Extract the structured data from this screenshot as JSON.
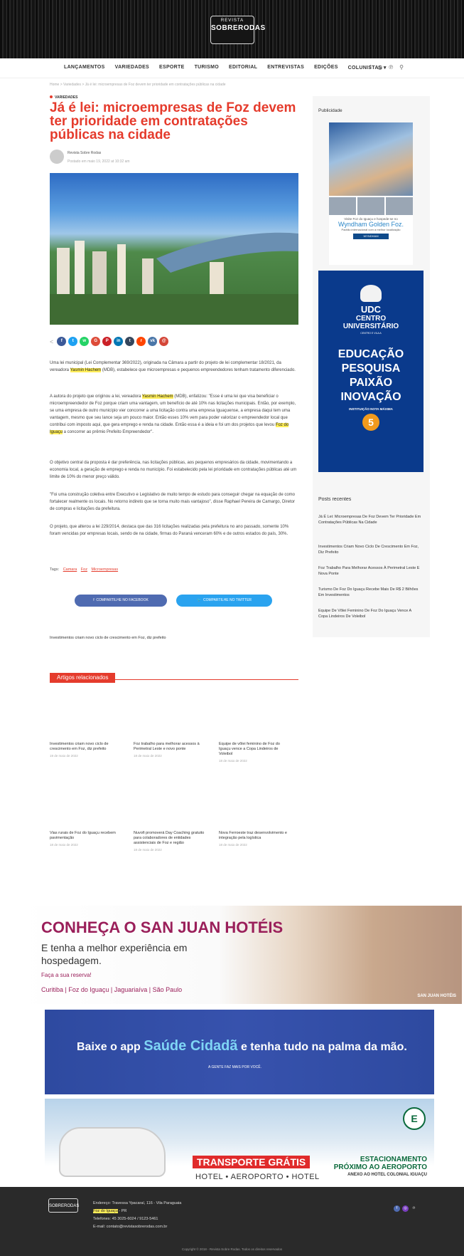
{
  "header": {
    "logo_small": "REVISTA",
    "logo_big": "SOBRERODAS",
    "nav": [
      "LANÇAMENTOS",
      "VARIEDADES",
      "ESPORTE",
      "TURISMO",
      "EDITORIAL",
      "ENTREVISTAS",
      "EDIÇÕES",
      "COLUNISTAS ▾"
    ],
    "icons": [
      "facebook-icon",
      "instagram-icon",
      "pinterest-icon",
      "search-icon"
    ]
  },
  "breadcrumb": "Home > Variedades > Já é lei: microempresas de Foz devem ter prioridade em contratações públicas na cidade",
  "article": {
    "category": "VARIEDADES",
    "title": "Já é lei: microempresas de Foz devem ter prioridade em contratações públicas na cidade",
    "author": "Revista Sobre Rodas",
    "date": "Postado em maio 19, 2022 at 10:32 am",
    "share_icons": [
      "facebook",
      "twitter",
      "whatsapp",
      "google",
      "pinterest",
      "linkedin",
      "tumblr",
      "reddit",
      "vk",
      "email"
    ],
    "paragraphs": [
      [
        "Uma lei municipal (Lei Complementar 369/2022), originada na Câmara a partir do projeto de lei complementar 18/2021, da vereadora ",
        "Yasmin Hachem",
        " (MDB), estabelece que microempresas e pequenos empreendedores tenham tratamento diferenciado."
      ],
      [
        "A autora do projeto que originou a lei, vereadora ",
        "Yasmin Hachem",
        " (MDB), enfatizou: \"Esse é uma lei que visa beneficiar o microempreendedor de Foz porque criam uma vantagem, um benefício de até 10% nas licitações municipais. Então, por exemplo, se uma empresa de outro município vier concorrer a uma licitação contra uma empresa Iguaçuense, a empresa daqui tem uma vantagem, mesmo que seu lance seja um pouco maior. Então esses 10% vem para poder valorizar o empreendedor local que contribui com imposto aqui, que gera emprego e renda na cidade. Então essa é a ideia e foi um dos projetos que levou ",
        "Foz do Iguaçu",
        " a concorrer ao prêmio Prefeito Empreendedor\"."
      ],
      [
        "O objetivo central da proposta é dar preferência, nas licitações públicas, aos pequenos empresários da cidade, movimentando a economia local, a geração de emprego e renda no município. Foi estabelecido pela lei prioridade em contratações públicas até um limite de 10% do menor preço válido.",
        "",
        ""
      ],
      [
        "\"Foi uma construção coletiva entre Executivo e Legislativo de muito tempo de estudo para conseguir chegar na equação de como fortalecer realmente os locais. No retorno indireto que se torna muito mais vantajoso\", disse Raphael Pereira de Camargo, Diretor de compras e licitações da prefeitura.",
        "",
        ""
      ],
      [
        "O projeto, que alterou a lei 229/2014, destaca que das 316 licitações realizadas pela prefeitura no ano passado, somente 10% foram vencidas por empresas locais, sendo de na cidade, firmas do Paraná venceram 60% e de outros estados do país, 30%.",
        "",
        ""
      ]
    ],
    "tags_label": "Tags:",
    "tags": [
      "Camara",
      "Foz",
      "Microempresas"
    ],
    "share_fb": "COMPARTILHE NO FACEBOOK",
    "share_tw": "COMPARTILHE NO TWITTER",
    "next_post": "Investimentos criam novo ciclo de crescimento em Foz, diz prefeito"
  },
  "related": {
    "heading": "Artigos relacionados",
    "items": [
      {
        "title": "Investimentos criam novo ciclo de crescimento em Foz, diz prefeito",
        "date": "19 de maio de 2022"
      },
      {
        "title": "Foz trabalho para melhorar acessos à Perimetral Leste e novo ponte",
        "date": "18 de maio de 2022"
      },
      {
        "title": "Equipe de vôlei feminino de Foz do Iguaçu vence a Copa Lindeiros de Voleibol",
        "date": "18 de maio de 2022"
      },
      {
        "title": "Vias rurais de Foz do Iguaçu recebem pavimentação",
        "date": "18 de maio de 2022"
      },
      {
        "title": "Nuvofi promoverá Day Coaching gratuito para colaboradores de entidades assistenciais de Foz e região",
        "date": "18 de maio de 2022"
      },
      {
        "title": "Nova Ferroeste traz desenvolvimento e integração pela logística",
        "date": "18 de maio de 2022"
      }
    ]
  },
  "sidebar": {
    "ad_title": "Publicidade",
    "wyndham_line1": "Visite Foz do Iguaçu e hospede-se no",
    "wyndham_name": "Wyndham Golden Foz.",
    "wyndham_line2": "Padrão internacional com a melhor localização",
    "wyndham_brand": "WYNDHAM",
    "udc": {
      "name": "UDC",
      "line1": "CENTRO",
      "line2": "UNIVERSITÁRIO",
      "small": "CENTRO E VILA A",
      "w1": "EDUCAÇÃO",
      "w2": "PESQUISA",
      "w3": "PAIXÃO",
      "w4": "INOVAÇÃO",
      "inst": "INSTITUIÇÃO NOTA MÁXIMA",
      "grade": "5"
    },
    "recent_title": "Posts recentes",
    "recent": [
      "Já É Lei: Microempresas De Foz Devem Ter Prioridade Em Contratações Públicas Na Cidade",
      "Investimentos Criam Novo Ciclo De Crescimento Em Foz, Diz Prefeito",
      "Foz Trabalho Para Melhorar Acessos À Perimetral Leste E Nova Ponte",
      "Turismo De Foz Do Iguaçu Recebe Mais De R$ 2 Bilhões Em Investimentos",
      "Equipe De Vôlei Feminino De Foz Do Iguaçu Vence A Copa Lindeiros De Voleibol"
    ]
  },
  "banners": {
    "sanjuan": {
      "heading": "CONHEÇA O SAN JUAN HOTÉIS",
      "sub": "E tenha a melhor experiência em hospedagem.",
      "cta": "Faça a sua reserva!",
      "cities": "Curitiba | Foz do Iguaçu | Jaguariaíva | São Paulo",
      "brand": "SAN JUAN HOTÉIS"
    },
    "saude": {
      "pre": "Baixe o app ",
      "app": "Saúde Cidadã",
      "post": " e tenha tudo na palma da mão.",
      "sub": "A GENTE FAZ MAIS POR VOCÊ."
    },
    "colonial": {
      "badge": "E",
      "transport": "TRANSPORTE GRÁTIS",
      "route": "HOTEL • AEROPORTO • HOTEL",
      "r1": "ESTACIONAMENTO",
      "r2": "PRÓXIMO AO AEROPORTO",
      "r3": "ANEXO AO HOTEL COLONIAL IGUAÇU"
    }
  },
  "footer": {
    "logo": "SOBRERODAS",
    "address": "Endereço: Travessa Ypacaraí, 116 - Vila Paraguaia",
    "city": "Foz do Iguaçu",
    "state": " - PR",
    "phones": "Telefones: 45 3025-6024 / 9123-5461",
    "email": "E-mail: contato@revistasobrerodas.com.br",
    "copyright": "Copyright © 2018 - Revista Sobre Rodas. Todos os direitos reservados"
  },
  "colors": {
    "accent": "#e53b2c",
    "highlight": "#ffee58",
    "facebook": "#4f6bb1",
    "twitter": "#2aa3ef"
  }
}
